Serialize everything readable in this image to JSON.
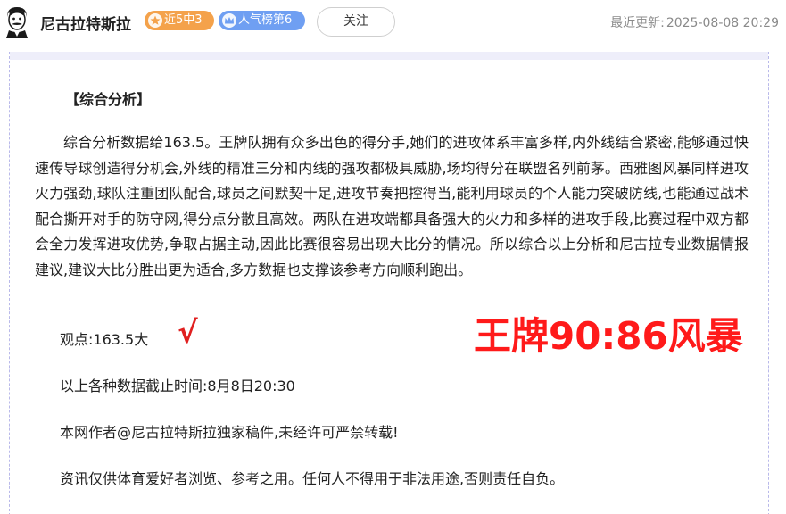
{
  "header": {
    "author_name": "尼古拉特斯拉",
    "badges": [
      {
        "text": "近5中3",
        "icon": "star-icon",
        "color": "#f4a24b"
      },
      {
        "text": "人气榜第6",
        "icon": "crown-icon",
        "color": "#6f9ff2"
      }
    ],
    "follow_label": "关注",
    "updated_label": "最近更新:",
    "updated_time": "2025-08-08 20:29"
  },
  "article": {
    "section_title": "【综合分析】",
    "analysis_text": "综合分析数据给163.5。王牌队拥有众多出色的得分手,她们的进攻体系丰富多样,内外线结合紧密,能够通过快速传导球创造得分机会,外线的精准三分和内线的强攻都极具威胁,场均得分在联盟名列前茅。西雅图风暴同样进攻火力强劲,球队注重团队配合,球员之间默契十足,进攻节奏把控得当,能利用球员的个人能力突破防线,也能通过战术配合撕开对手的防守网,得分点分散且高效。两队在进攻端都具备强大的火力和多样的进攻手段,比赛过程中双方都会全力发挥进攻优势,争取占据主动,因此比赛很容易出现大比分的情况。所以综合以上分析和尼古拉专业数据情报建议,建议大比分胜出更为适合,多方数据也支撑该参考方向顺利跑出。",
    "view_line": "观点:163.5大",
    "check_mark": "√",
    "score_overlay": "王牌90:86风暴",
    "cutoff_line": "以上各种数据截止时间:8月8日20:30",
    "author_line": "本网作者@尼古拉特斯拉独家稿件,未经许可严禁转载!",
    "disclaimer_line": "资讯仅供体育爱好者浏览、参考之用。任何人不得用于非法用途,否则责任自负。"
  },
  "colors": {
    "accent_red": "#ff1a1a",
    "card_border": "#b9b9ea",
    "muted_text": "#8a8a8a"
  }
}
